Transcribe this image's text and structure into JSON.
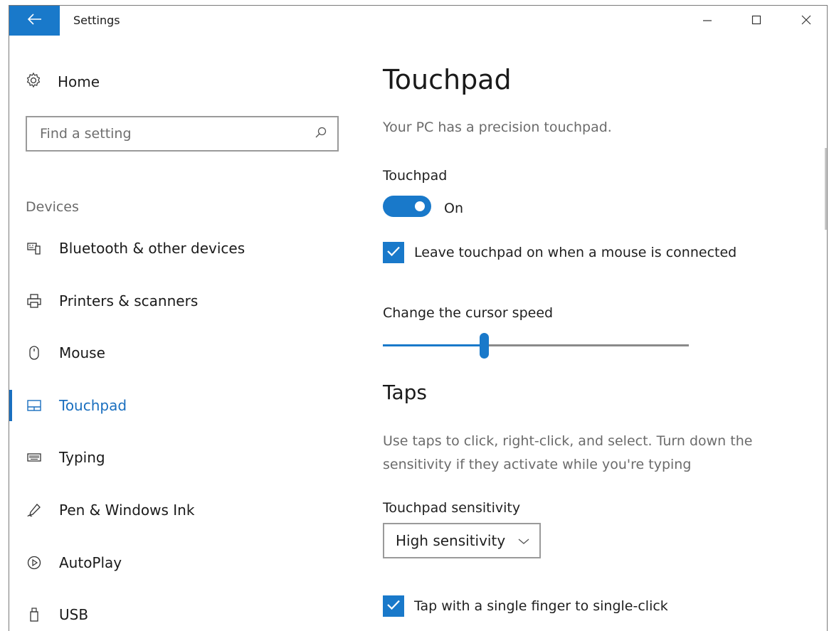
{
  "window": {
    "title": "Settings",
    "accent_color": "#1979ca",
    "controls": [
      "minimize-icon",
      "maximize-icon",
      "close-icon"
    ]
  },
  "sidebar": {
    "home_label": "Home",
    "search": {
      "placeholder": "Find a setting",
      "value": ""
    },
    "section_header": "Devices",
    "items": [
      {
        "label": "Bluetooth & other devices",
        "icon": "bluetooth-devices-icon",
        "active": false
      },
      {
        "label": "Printers & scanners",
        "icon": "printer-icon",
        "active": false
      },
      {
        "label": "Mouse",
        "icon": "mouse-icon",
        "active": false
      },
      {
        "label": "Touchpad",
        "icon": "touchpad-icon",
        "active": true
      },
      {
        "label": "Typing",
        "icon": "keyboard-icon",
        "active": false
      },
      {
        "label": "Pen & Windows Ink",
        "icon": "pen-icon",
        "active": false
      },
      {
        "label": "AutoPlay",
        "icon": "autoplay-icon",
        "active": false
      },
      {
        "label": "USB",
        "icon": "usb-icon",
        "active": false
      }
    ]
  },
  "content": {
    "title": "Touchpad",
    "subtitle": "Your PC has a precision touchpad.",
    "touchpad_toggle": {
      "label": "Touchpad",
      "state": "On",
      "on": true
    },
    "leave_on_checkbox": {
      "label": "Leave touchpad on when a mouse is connected",
      "checked": true
    },
    "cursor_speed": {
      "label": "Change the cursor speed",
      "value_fraction": 0.33
    },
    "taps": {
      "heading": "Taps",
      "description": "Use taps to click, right-click, and select. Turn down the sensitivity if they activate while you're typing",
      "sensitivity_label": "Touchpad sensitivity",
      "sensitivity_value": "High sensitivity",
      "single_tap_checkbox": {
        "label": "Tap with a single finger to single-click",
        "checked": true
      }
    }
  }
}
